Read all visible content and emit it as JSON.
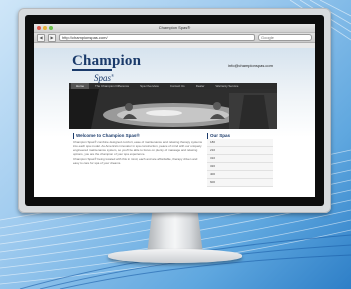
{
  "browser": {
    "window_title": "Champion Spas®",
    "back_label": "◀",
    "forward_label": "▶",
    "url": "http://championspas.com/",
    "search_placeholder": "Google"
  },
  "site": {
    "logo_top": "Champion",
    "logo_bottom": "Spas",
    "logo_mark": "®",
    "email": "info@championspas.com",
    "nav": [
      "Home",
      "The Champion Difference",
      "Spa Overview",
      "Contact Us",
      "Dealer",
      "Warranty Service"
    ],
    "welcome_heading": "Welcome to Champion Spas®",
    "welcome_text_1": "Champion Spas® combine designed comfort, ease of maintenance and relaxing therapy systems into each spa model. As America's innovator in spa construction, peace of mind with our uniquely engineered maintenance system, so you'll be able to focus on plenty of massage and relaxing options, you are the champion of your spa experience.",
    "welcome_text_2": "Champion Spas® being located with this in mind, each and are affordable, therapy driven and easy to care for spa of your dreams.",
    "our_spas_heading": "Our Spas",
    "spas": [
      "180",
      "210",
      "310",
      "320",
      "400",
      "600"
    ]
  }
}
